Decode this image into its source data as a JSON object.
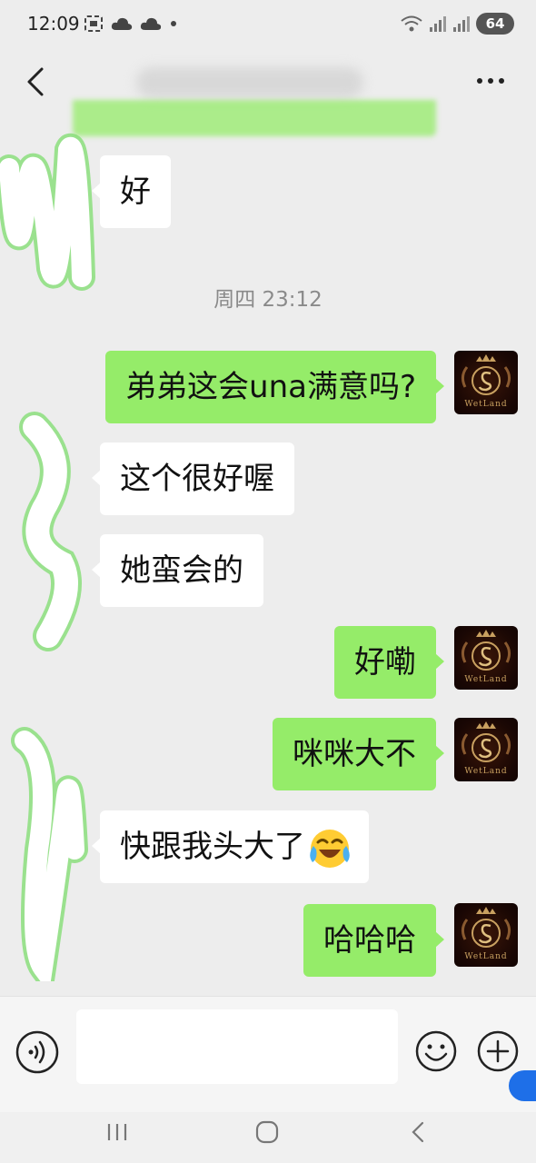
{
  "status_bar": {
    "time": "12:09",
    "battery": "64"
  },
  "header": {
    "title": "••••••••"
  },
  "timestamp": "周四 23:12",
  "messages": [
    {
      "side": "in",
      "text": "好"
    },
    {
      "side": "out",
      "text": "弟弟这会una满意吗?"
    },
    {
      "side": "in",
      "text": "这个很好喔"
    },
    {
      "side": "in",
      "text": "她蛮会的"
    },
    {
      "side": "out",
      "text": "好嘞"
    },
    {
      "side": "out",
      "text": "咪咪大不"
    },
    {
      "side": "in",
      "text": "快跟我头大了"
    },
    {
      "side": "out",
      "text": "哈哈哈"
    }
  ],
  "avatar": {
    "label": "WetLand"
  },
  "input": {
    "value": ""
  },
  "colors": {
    "out_bubble": "#95ec69",
    "in_bubble": "#ffffff",
    "background": "#ededed"
  },
  "icons": [
    "back-arrow-icon",
    "more-icon",
    "voice-icon",
    "emoji-icon",
    "plus-icon",
    "laughing-crying-emoji"
  ]
}
